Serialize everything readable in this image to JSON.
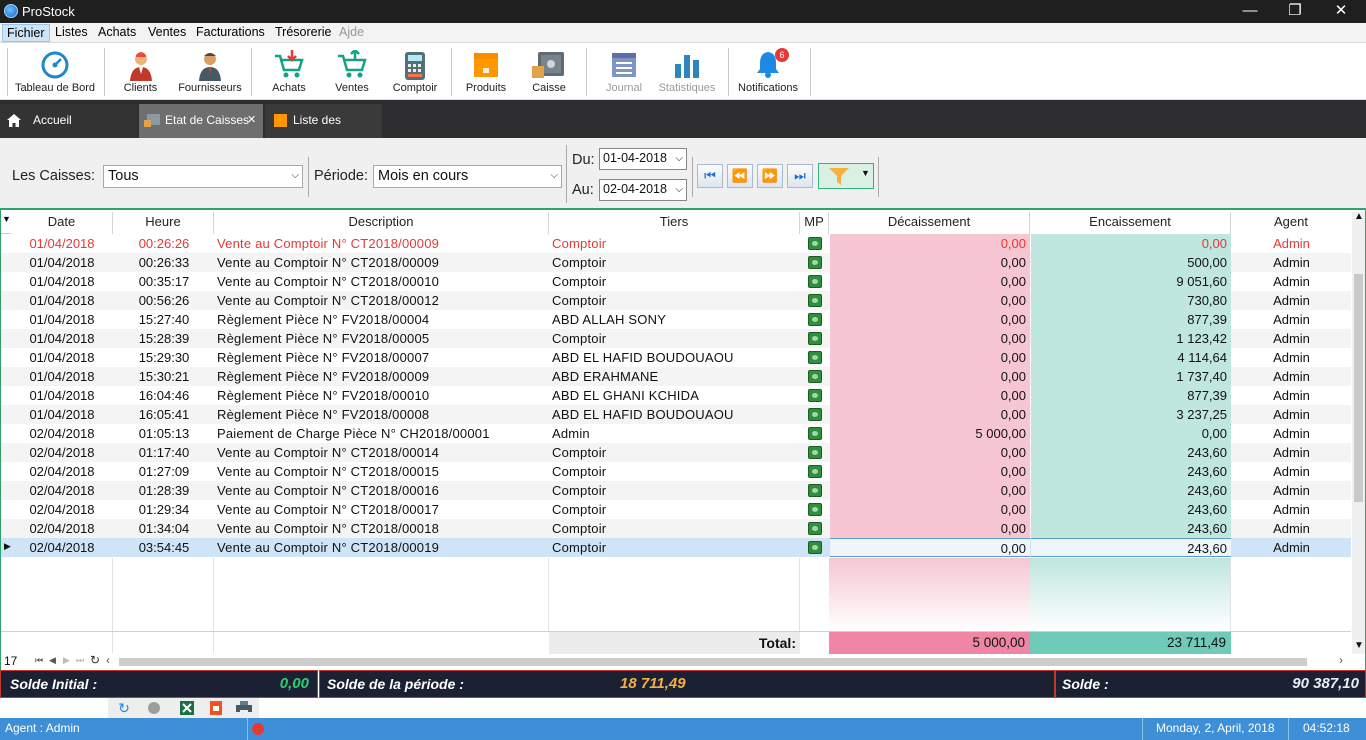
{
  "window": {
    "title": "ProStock",
    "min": "—",
    "max": "❐",
    "close": "✕"
  },
  "menu": [
    "Fichier",
    "Listes",
    "Achats",
    "Ventes",
    "Facturations",
    "Trésorerie",
    "Ajde"
  ],
  "toolbar": {
    "tableau": "Tableau de Bord",
    "clients": "Clients",
    "fournisseurs": "Fournisseurs",
    "achats": "Achats",
    "ventes": "Ventes",
    "comptoir": "Comptoir",
    "produits": "Produits",
    "caisse": "Caisse",
    "journal": "Journal",
    "statistiques": "Statistiques",
    "notifications": "Notifications",
    "notif_count": "6"
  },
  "tabs": {
    "accueil": "Accueil",
    "etat": "Etat de Caisses",
    "liste": "Liste des Produits",
    "close": "✕"
  },
  "filter": {
    "caisses_label": "Les Caisses:",
    "caisses_value": "Tous",
    "periode_label": "Période:",
    "periode_value": "Mois en cours",
    "du_label": "Du:",
    "du_value": "01-04-2018",
    "au_label": "Au:",
    "au_value": "02-04-2018"
  },
  "grid": {
    "headers": [
      "Date",
      "Heure",
      "Description",
      "Tiers",
      "MP",
      "Décaissement",
      "Encaissement",
      "Agent"
    ],
    "rows": [
      [
        "01/04/2018",
        "00:26:26",
        "Vente au Comptoir N° CT2018/00009",
        "Comptoir",
        "0,00",
        "0,00",
        "Admin"
      ],
      [
        "01/04/2018",
        "00:26:33",
        "Vente au Comptoir N° CT2018/00009",
        "Comptoir",
        "0,00",
        "500,00",
        "Admin"
      ],
      [
        "01/04/2018",
        "00:35:17",
        "Vente au Comptoir N° CT2018/00010",
        "Comptoir",
        "0,00",
        "9 051,60",
        "Admin"
      ],
      [
        "01/04/2018",
        "00:56:26",
        "Vente au Comptoir N° CT2018/00012",
        "Comptoir",
        "0,00",
        "730,80",
        "Admin"
      ],
      [
        "01/04/2018",
        "15:27:40",
        "Règlement  Pièce N° FV2018/00004",
        "ABD ALLAH SONY",
        "0,00",
        "877,39",
        "Admin"
      ],
      [
        "01/04/2018",
        "15:28:39",
        "Règlement  Pièce N° FV2018/00005",
        "Comptoir",
        "0,00",
        "1 123,42",
        "Admin"
      ],
      [
        "01/04/2018",
        "15:29:30",
        "Règlement  Pièce N° FV2018/00007",
        "ABD EL HAFID BOUDOUAOU",
        "0,00",
        "4 114,64",
        "Admin"
      ],
      [
        "01/04/2018",
        "15:30:21",
        "Règlement  Pièce N° FV2018/00009",
        "ABD ERAHMANE",
        "0,00",
        "1 737,40",
        "Admin"
      ],
      [
        "01/04/2018",
        "16:04:46",
        "Règlement  Pièce N° FV2018/00010",
        "ABD EL GHANI KCHIDA",
        "0,00",
        "877,39",
        "Admin"
      ],
      [
        "01/04/2018",
        "16:05:41",
        "Règlement  Pièce N° FV2018/00008",
        "ABD EL HAFID BOUDOUAOU",
        "0,00",
        "3 237,25",
        "Admin"
      ],
      [
        "02/04/2018",
        "01:05:13",
        "Paiement de Charge Pièce N° CH2018/00001",
        "Admin",
        "5 000,00",
        "0,00",
        "Admin"
      ],
      [
        "02/04/2018",
        "01:17:40",
        "Vente au Comptoir N° CT2018/00014",
        "Comptoir",
        "0,00",
        "243,60",
        "Admin"
      ],
      [
        "02/04/2018",
        "01:27:09",
        "Vente au Comptoir N° CT2018/00015",
        "Comptoir",
        "0,00",
        "243,60",
        "Admin"
      ],
      [
        "02/04/2018",
        "01:28:39",
        "Vente au Comptoir N° CT2018/00016",
        "Comptoir",
        "0,00",
        "243,60",
        "Admin"
      ],
      [
        "02/04/2018",
        "01:29:34",
        "Vente au Comptoir N° CT2018/00017",
        "Comptoir",
        "0,00",
        "243,60",
        "Admin"
      ],
      [
        "02/04/2018",
        "01:34:04",
        "Vente au Comptoir N° CT2018/00018",
        "Comptoir",
        "0,00",
        "243,60",
        "Admin"
      ],
      [
        "02/04/2018",
        "03:54:45",
        "Vente au Comptoir N° CT2018/00019",
        "Comptoir",
        "0,00",
        "243,60",
        "Admin"
      ]
    ],
    "total_label": "Total:",
    "total_dec": "5 000,00",
    "total_enc": "23 711,49",
    "row_count": "17"
  },
  "summary": {
    "initial_label": "Solde Initial :",
    "initial_value": "0,00",
    "periode_label": "Solde de la période :",
    "periode_value": "18 711,49",
    "solde_label": "Solde :",
    "solde_value": "90 387,10"
  },
  "status": {
    "agent": "Agent : Admin",
    "date": "Monday, 2,  April, 2018",
    "time": "04:52:18"
  },
  "colors": {
    "accent_green": "#2fa36b",
    "decaissement": "#f6c6d2",
    "encaissement": "#bfe6df",
    "status_blue": "#3f8fd6",
    "negative_red": "#e53935"
  }
}
